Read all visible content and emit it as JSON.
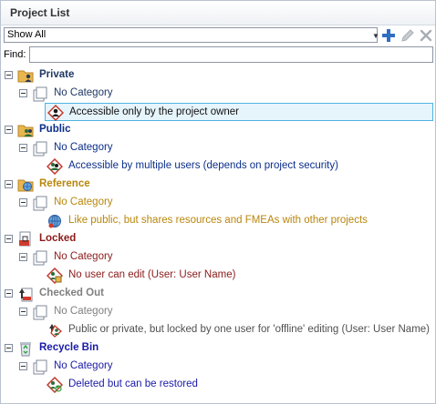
{
  "title": "Project List",
  "filter": {
    "value": "Show All"
  },
  "find": {
    "label": "Find:",
    "value": "",
    "placeholder": ""
  },
  "colors": {
    "private": "#1f3864",
    "public": "#0b2e8a",
    "reference": "#b8860b",
    "locked": "#8b1a1a",
    "checked_out": "#808080",
    "recycle_bin": "#1a1aa8",
    "selection_border": "#4fb3e3",
    "selection_fill": "#e6f4fc"
  },
  "groups": [
    {
      "key": "private",
      "label": "Private",
      "category": "No Category",
      "item": "Accessible only by the project owner",
      "icon": "private-folder-icon",
      "item_icon": "owner-only-icon",
      "selected": true
    },
    {
      "key": "public",
      "label": "Public",
      "category": "No Category",
      "item": "Accessible by multiple users (depends on project security)",
      "icon": "public-folder-icon",
      "item_icon": "shared-users-icon",
      "selected": false
    },
    {
      "key": "reference",
      "label": "Reference",
      "category": "No Category",
      "item": "Like public, but shares resources and FMEAs with other projects",
      "icon": "reference-globe-icon",
      "item_icon": "reference-globe-icon",
      "selected": false
    },
    {
      "key": "locked",
      "label": "Locked",
      "category": "No Category",
      "item": "No user can edit (User: User Name)",
      "icon": "locked-document-icon",
      "item_icon": "locked-users-icon",
      "selected": false
    },
    {
      "key": "checked_out",
      "label": "Checked Out",
      "category": "No Category",
      "item": "Public or private, but locked by one user for 'offline' editing (User: User Name)",
      "icon": "checked-out-icon",
      "item_icon": "checked-out-user-icon",
      "selected": false
    },
    {
      "key": "recycle_bin",
      "label": "Recycle Bin",
      "category": "No Category",
      "item": "Deleted but can be restored",
      "icon": "recycle-bin-icon",
      "item_icon": "deleted-users-icon",
      "selected": false
    }
  ]
}
